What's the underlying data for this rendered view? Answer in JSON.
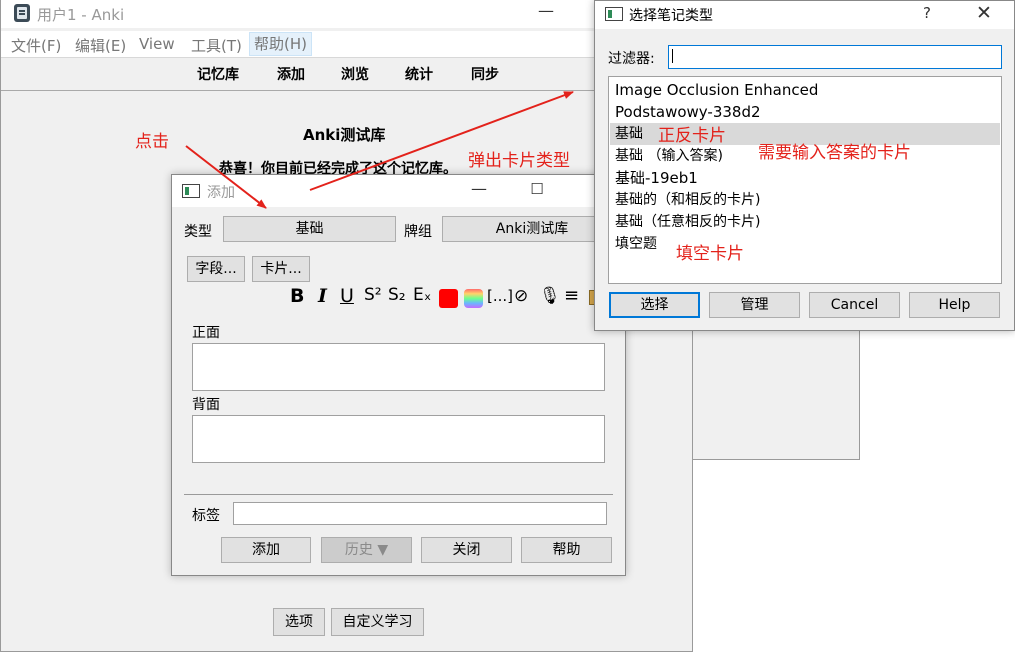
{
  "main": {
    "title": "用户1 - Anki",
    "menu": [
      "文件(F)",
      "编辑(E)",
      "View",
      "工具(T)",
      "帮助(H)"
    ],
    "toolbar": [
      "记忆库",
      "添加",
      "浏览",
      "统计",
      "同步"
    ],
    "deck_title": "Anki测试库",
    "deck_message": "恭喜！你目前已经完成了这个记忆库。",
    "buttons": {
      "options": "选项",
      "custom_study": "自定义学习"
    }
  },
  "add": {
    "title": "添加",
    "type_label": "类型",
    "type_value": "基础",
    "deck_label": "牌组",
    "deck_value": "Anki测试库",
    "fields_button": "字段...",
    "cards_button": "卡片...",
    "front_label": "正面",
    "back_label": "背面",
    "tags_label": "标签",
    "add_button": "添加",
    "history_button": "历史 ▼",
    "close_button": "关闭",
    "help_button": "帮助"
  },
  "notetype": {
    "title": "选择笔记类型",
    "help_glyph": "?",
    "filter_label": "过滤器:",
    "filter_value": "",
    "items": [
      "Image Occlusion Enhanced",
      "Podstawowy-338d2",
      "基础",
      "基础 （输入答案)",
      "基础-19eb1",
      "基础的（和相反的卡片)",
      "基础（任意相反的卡片)",
      "填空题"
    ],
    "buttons": {
      "choose": "选择",
      "manage": "管理",
      "cancel": "Cancel",
      "help": "Help"
    }
  },
  "annotations": {
    "click": "点击",
    "popup": "弹出卡片类型",
    "forward_card": "正反卡片",
    "type_answer_card": "需要输入答案的卡片",
    "cloze_card": "填空卡片"
  },
  "colors": {
    "annotation": "#e3221b",
    "focus": "#0078d7",
    "selection": "#d9d9d9"
  }
}
